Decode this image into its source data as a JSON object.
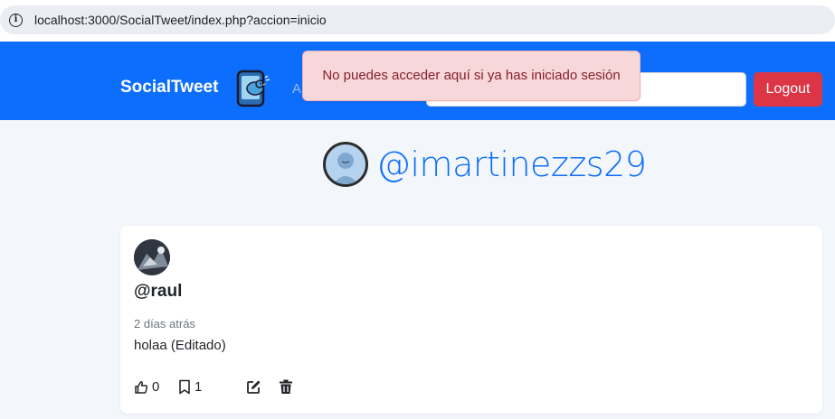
{
  "browser": {
    "url": "localhost:3000/SocialTweet/index.php?accion=inicio"
  },
  "navbar": {
    "brand": "SocialTweet",
    "nav_link_partial": "A",
    "search_placeholder": "",
    "logout_label": "Logout"
  },
  "alert": {
    "message": "No puedes acceder aquí si ya has iniciado sesión"
  },
  "profile": {
    "handle": "@imartinezzs29"
  },
  "tweet": {
    "author": "@raul",
    "time": "2 días atrás",
    "body": "holaa (Editado)",
    "likes": "0",
    "saves": "1"
  },
  "colors": {
    "primary": "#0d6efd",
    "danger": "#dc3545",
    "alert_bg": "#f8d7da",
    "alert_text": "#842029",
    "page_bg": "#f3f6fa"
  },
  "icons": [
    "info-icon",
    "bird-phone-logo-icon",
    "thumbs-up-icon",
    "bookmark-icon",
    "edit-icon",
    "trash-icon"
  ]
}
